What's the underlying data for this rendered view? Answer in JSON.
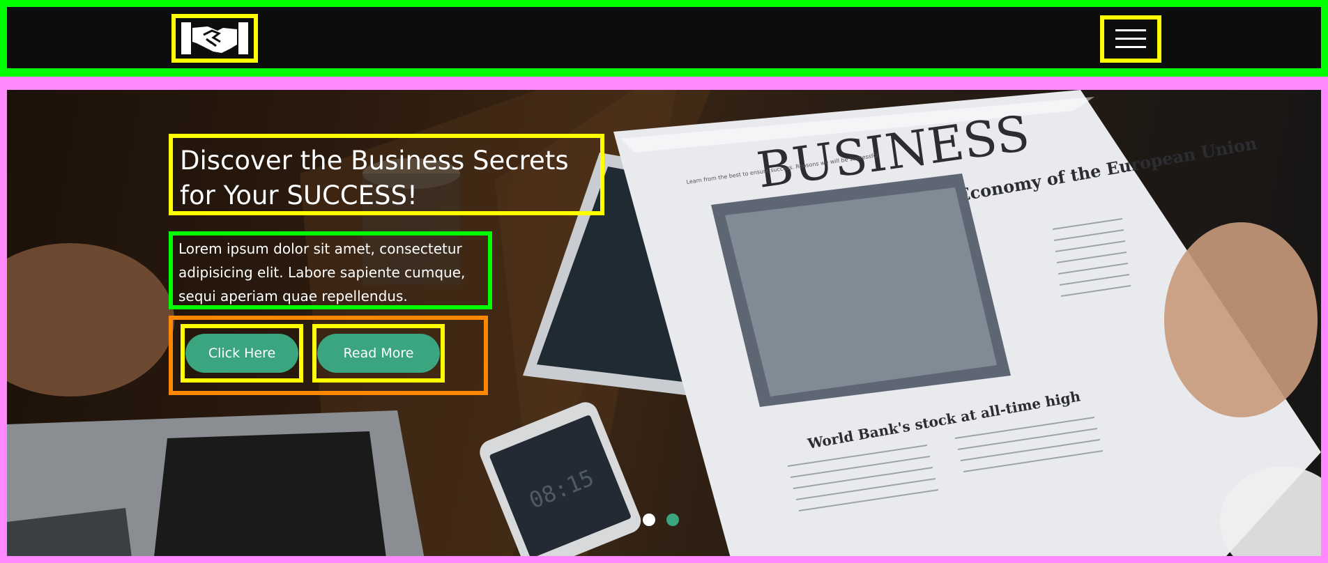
{
  "brand": {
    "logo_icon": "handshake-icon"
  },
  "nav": {
    "menu_icon": "hamburger-menu-icon"
  },
  "hero": {
    "title": "Discover the Business Secrets for Your SUCCESS!",
    "description": "Lorem ipsum dolor sit amet, consectetur adipisicing elit. Labore sapiente cumque, sequi aperiam quae repellendus.",
    "buttons": [
      {
        "label": "Click Here"
      },
      {
        "label": "Read More"
      }
    ],
    "newspaper": {
      "masthead": "BUSINESS",
      "headline": "Economy of the European Union",
      "subheadline": "World Bank's stock at all-time high",
      "tagline": "Learn from the best to ensure success. Reasons we will be successful"
    },
    "phone_time": "08:15"
  },
  "carousel": {
    "slide_count": 2,
    "active_index": 0
  },
  "colors": {
    "accent": "#3aa57f",
    "nav_bg": "#0c0d0c"
  }
}
